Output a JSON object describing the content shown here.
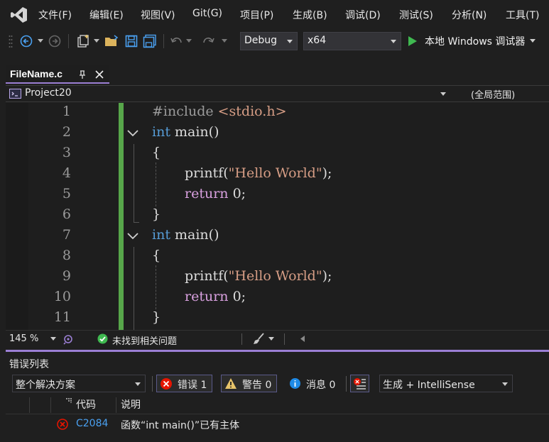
{
  "menu": [
    "文件(F)",
    "编辑(E)",
    "视图(V)",
    "Git(G)",
    "项目(P)",
    "生成(B)",
    "调试(D)",
    "测试(S)",
    "分析(N)",
    "工具(T)"
  ],
  "toolbar": {
    "config": "Debug",
    "platform": "x64",
    "run_label": "本地 Windows 调试器"
  },
  "tab": {
    "title": "FileName.c"
  },
  "navbar": {
    "project": "Project20",
    "scope": "(全局范围)"
  },
  "editor": {
    "line_numbers": [
      "1",
      "2",
      "3",
      "4",
      "5",
      "6",
      "7",
      "8",
      "9",
      "10",
      "11"
    ],
    "lines": [
      [
        "#include ",
        "<stdio.h>"
      ],
      [
        "int",
        " main()"
      ],
      [
        "{"
      ],
      [
        "printf(",
        "\"Hello World\"",
        ");"
      ],
      [
        "return",
        " 0;"
      ],
      [
        "}"
      ],
      [
        "int",
        " main()"
      ],
      [
        "{"
      ],
      [
        "printf(",
        "\"Hello World\"",
        ");"
      ],
      [
        "return",
        " 0;"
      ],
      [
        "}"
      ]
    ]
  },
  "status": {
    "zoom": "145 %",
    "issues": "未找到相关问题"
  },
  "error_list": {
    "title": "错误列表",
    "scope": "整个解决方案",
    "errors": "错误 1",
    "warnings": "警告 0",
    "messages": "消息 0",
    "source": "生成 + IntelliSense",
    "columns": {
      "code": "代码",
      "description": "说明"
    },
    "rows": [
      {
        "code": "C2084",
        "description": "函数“int main()”已有主体"
      }
    ]
  },
  "colors": {
    "accent": "#9b7fd4",
    "change_bar": "#57a64a",
    "error": "#e51400",
    "keyword": "#569cd6",
    "string": "#d69d85"
  }
}
